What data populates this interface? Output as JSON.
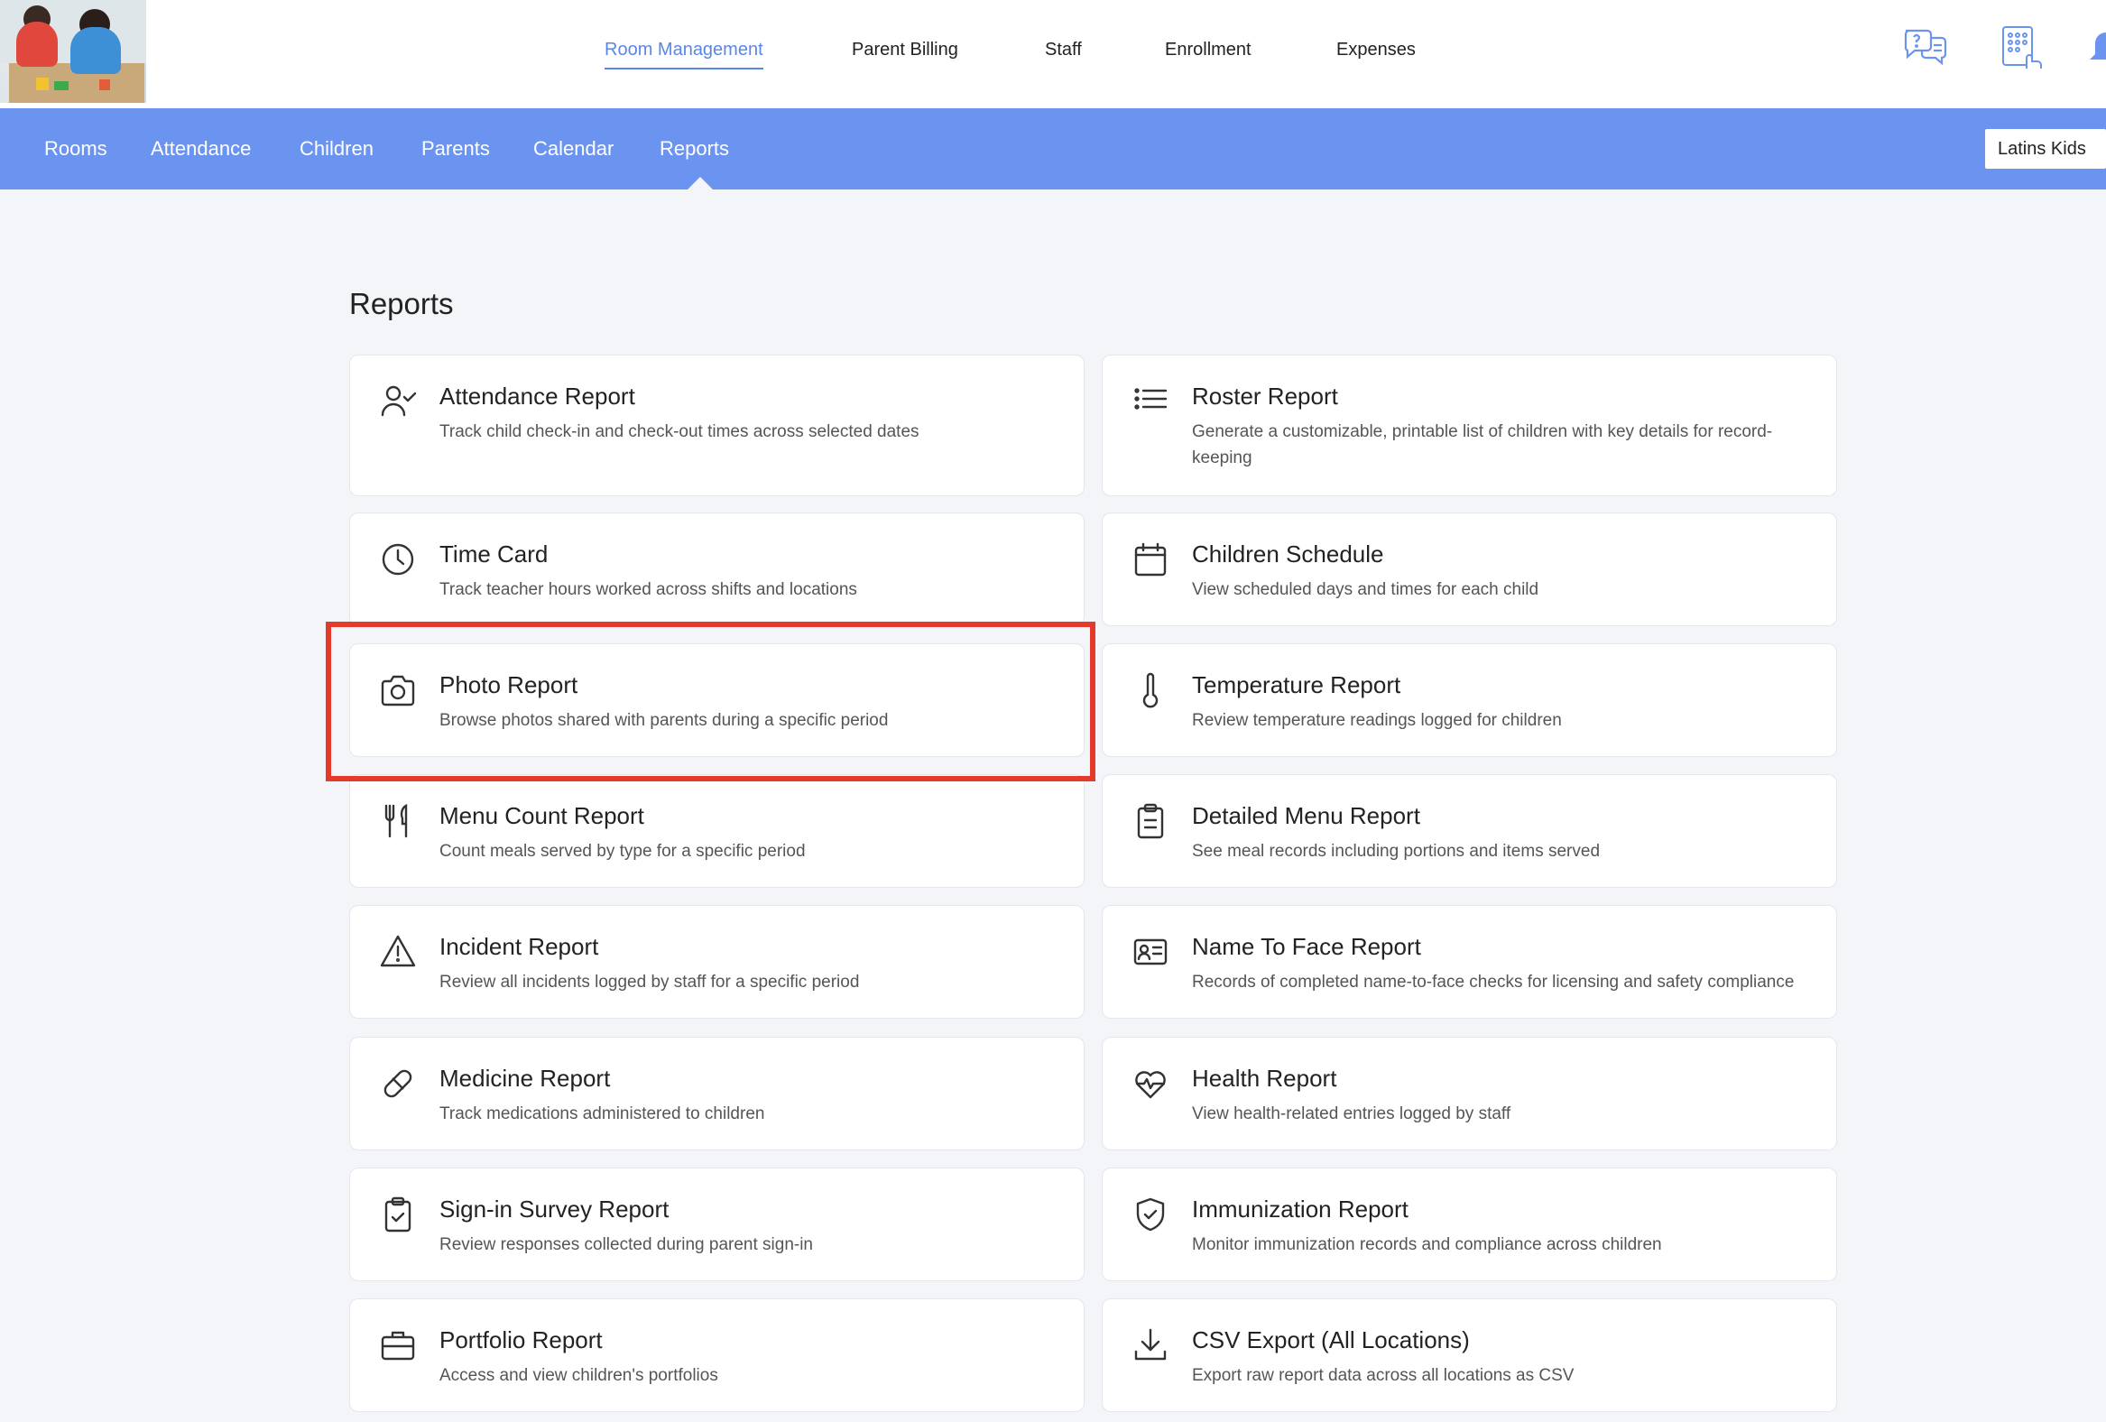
{
  "header": {
    "nav": [
      {
        "label": "Room Management",
        "active": true
      },
      {
        "label": "Parent Billing",
        "active": false
      },
      {
        "label": "Staff",
        "active": false
      },
      {
        "label": "Enrollment",
        "active": false
      },
      {
        "label": "Expenses",
        "active": false
      }
    ],
    "icons": [
      "help-chat-icon",
      "keypad-checkin-icon",
      "notification-bell-icon"
    ],
    "accent_color": "#5a86e6"
  },
  "subnav": {
    "items": [
      {
        "label": "Rooms"
      },
      {
        "label": "Attendance"
      },
      {
        "label": "Children"
      },
      {
        "label": "Parents"
      },
      {
        "label": "Calendar"
      },
      {
        "label": "Reports",
        "active": true
      }
    ],
    "location": "Latins Kids",
    "bar_color": "#6b93f0"
  },
  "main": {
    "title": "Reports",
    "reports": [
      {
        "icon": "user-check-icon",
        "title": "Attendance Report",
        "desc": "Track child check-in and check-out times across selected dates"
      },
      {
        "icon": "list-icon",
        "title": "Roster Report",
        "desc": "Generate a customizable, printable list of children with key details for record-keeping"
      },
      {
        "icon": "clock-icon",
        "title": "Time Card",
        "desc": "Track teacher hours worked across shifts and locations"
      },
      {
        "icon": "calendar-icon",
        "title": "Children Schedule",
        "desc": "View scheduled days and times for each child"
      },
      {
        "icon": "camera-icon",
        "title": "Photo Report",
        "desc": "Browse photos shared with parents during a specific period"
      },
      {
        "icon": "thermometer-icon",
        "title": "Temperature Report",
        "desc": "Review temperature readings logged for children"
      },
      {
        "icon": "utensils-icon",
        "title": "Menu Count Report",
        "desc": "Count meals served by type for a specific period"
      },
      {
        "icon": "clipboard-icon",
        "title": "Detailed Menu Report",
        "desc": "See meal records including portions and items served"
      },
      {
        "icon": "warning-icon",
        "title": "Incident Report",
        "desc": "Review all incidents logged by staff for a specific period"
      },
      {
        "icon": "id-card-icon",
        "title": "Name To Face Report",
        "desc": "Records of completed name-to-face checks for licensing and safety compliance"
      },
      {
        "icon": "pill-icon",
        "title": "Medicine Report",
        "desc": "Track medications administered to children"
      },
      {
        "icon": "heart-pulse-icon",
        "title": "Health Report",
        "desc": "View health-related entries logged by staff"
      },
      {
        "icon": "clipboard-check-icon",
        "title": "Sign-in Survey Report",
        "desc": "Review responses collected during parent sign-in"
      },
      {
        "icon": "shield-check-icon",
        "title": "Immunization Report",
        "desc": "Monitor immunization records and compliance across children"
      },
      {
        "icon": "briefcase-icon",
        "title": "Portfolio Report",
        "desc": "Access and view children's portfolios"
      },
      {
        "icon": "download-icon",
        "title": "CSV Export (All Locations)",
        "desc": "Export raw report data across all locations as CSV"
      }
    ],
    "highlighted_report": "Photo Report",
    "highlight_color": "#e53a2b"
  }
}
